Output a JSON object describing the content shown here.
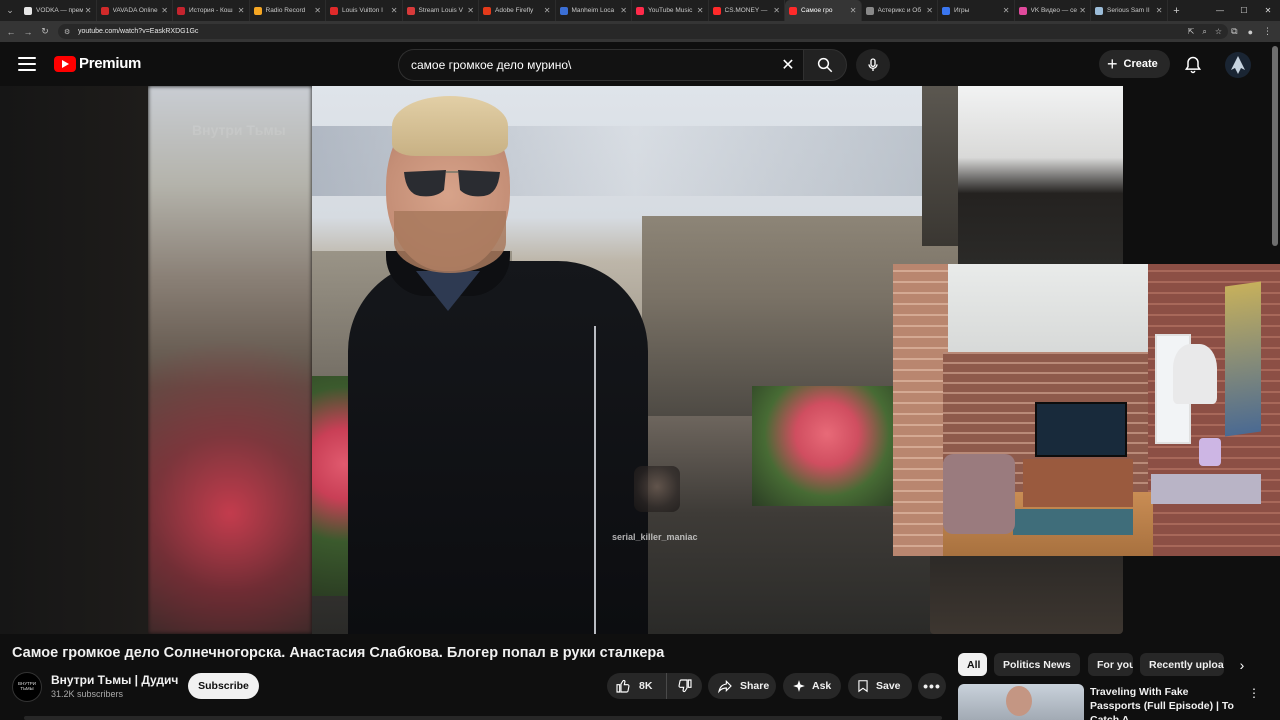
{
  "browser": {
    "tabs": [
      {
        "title": "VODKA — прем",
        "color": "#e6e6e6"
      },
      {
        "title": "VAVADA Online",
        "color": "#d12a2a"
      },
      {
        "title": "История - Кош",
        "color": "#c4242e"
      },
      {
        "title": "Radio Record",
        "color": "#f5a623"
      },
      {
        "title": "Louis Vuitton I",
        "color": "#e02a2a"
      },
      {
        "title": "Stream Louis V",
        "color": "#d83a3a"
      },
      {
        "title": "Adobe Firefly",
        "color": "#e43a1a"
      },
      {
        "title": "Manheim Loca",
        "color": "#3b6fd6"
      },
      {
        "title": "YouTube Music",
        "color": "#ff2a4a"
      },
      {
        "title": "CS.MONEY —",
        "color": "#ff2a2a"
      },
      {
        "title": "Самое гро",
        "color": "#ff2a2a"
      },
      {
        "title": "Астерикс и Об",
        "color": "#888888"
      },
      {
        "title": "Игры",
        "color": "#3a76f0"
      },
      {
        "title": "VK Видео — се",
        "color": "#e04a9c"
      },
      {
        "title": "Serious Sam II",
        "color": "#9bbcd8"
      }
    ],
    "active_tab_index": 10,
    "url": "youtube.com/watch?v=EaskRXDG1Gc"
  },
  "header": {
    "logo_text": "Premium",
    "search_value": "самое громкое дело мурино\\",
    "create_label": "Create"
  },
  "video": {
    "watermark": "serial_killer_maniac",
    "watermark_top": "Внутри Тьмы",
    "title": "Самое громкое дело Солнечногорска. Анастасия Слабкова. Блогер попал в руки сталкера",
    "channel_name": "Внутри Тьмы | Дудич",
    "channel_avatar_text": "ВНУТРИ ТЬМЫ",
    "subscribers": "31.2K subscribers",
    "subscribe_label": "Subscribe",
    "likes": "8K",
    "share_label": "Share",
    "ask_label": "Ask",
    "save_label": "Save"
  },
  "sidebar": {
    "chips": [
      "All",
      "Politics News",
      "For you",
      "Recently uploa"
    ],
    "selected_chip": 0,
    "recommendation": {
      "title": "Traveling With Fake Passports (Full Episode) | To Catch A ..."
    }
  }
}
